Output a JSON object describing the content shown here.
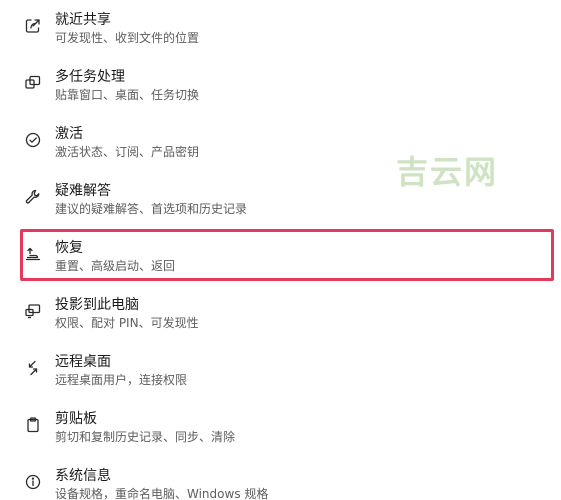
{
  "items": [
    {
      "id": "nearby-sharing",
      "icon": "share-icon",
      "title": "就近共享",
      "subtitle": "可发现性、收到文件的位置"
    },
    {
      "id": "multitasking",
      "icon": "multitask-icon",
      "title": "多任务处理",
      "subtitle": "贴靠窗口、桌面、任务切换"
    },
    {
      "id": "activation",
      "icon": "check-circle-icon",
      "title": "激活",
      "subtitle": "激活状态、订阅、产品密钥"
    },
    {
      "id": "troubleshoot",
      "icon": "wrench-icon",
      "title": "疑难解答",
      "subtitle": "建议的疑难解答、首选项和历史记录"
    },
    {
      "id": "recovery",
      "icon": "recovery-icon",
      "title": "恢复",
      "subtitle": "重置、高级启动、返回"
    },
    {
      "id": "project-to-pc",
      "icon": "projector-icon",
      "title": "投影到此电脑",
      "subtitle": "权限、配对 PIN、可发现性"
    },
    {
      "id": "remote-desktop",
      "icon": "remote-desktop-icon",
      "title": "远程桌面",
      "subtitle": "远程桌面用户，连接权限"
    },
    {
      "id": "clipboard",
      "icon": "clipboard-icon",
      "title": "剪贴板",
      "subtitle": "剪切和复制历史记录、同步、清除"
    },
    {
      "id": "about",
      "icon": "info-icon",
      "title": "系统信息",
      "subtitle": "设备规格，重命名电脑、Windows 规格"
    }
  ],
  "highlighted_item": "recovery",
  "watermark": "吉云网",
  "colors": {
    "highlight_border": "#e6375c",
    "watermark": "#cfe3c4",
    "title_text": "#1b1b1b",
    "subtitle_text": "#5d5d5d"
  }
}
